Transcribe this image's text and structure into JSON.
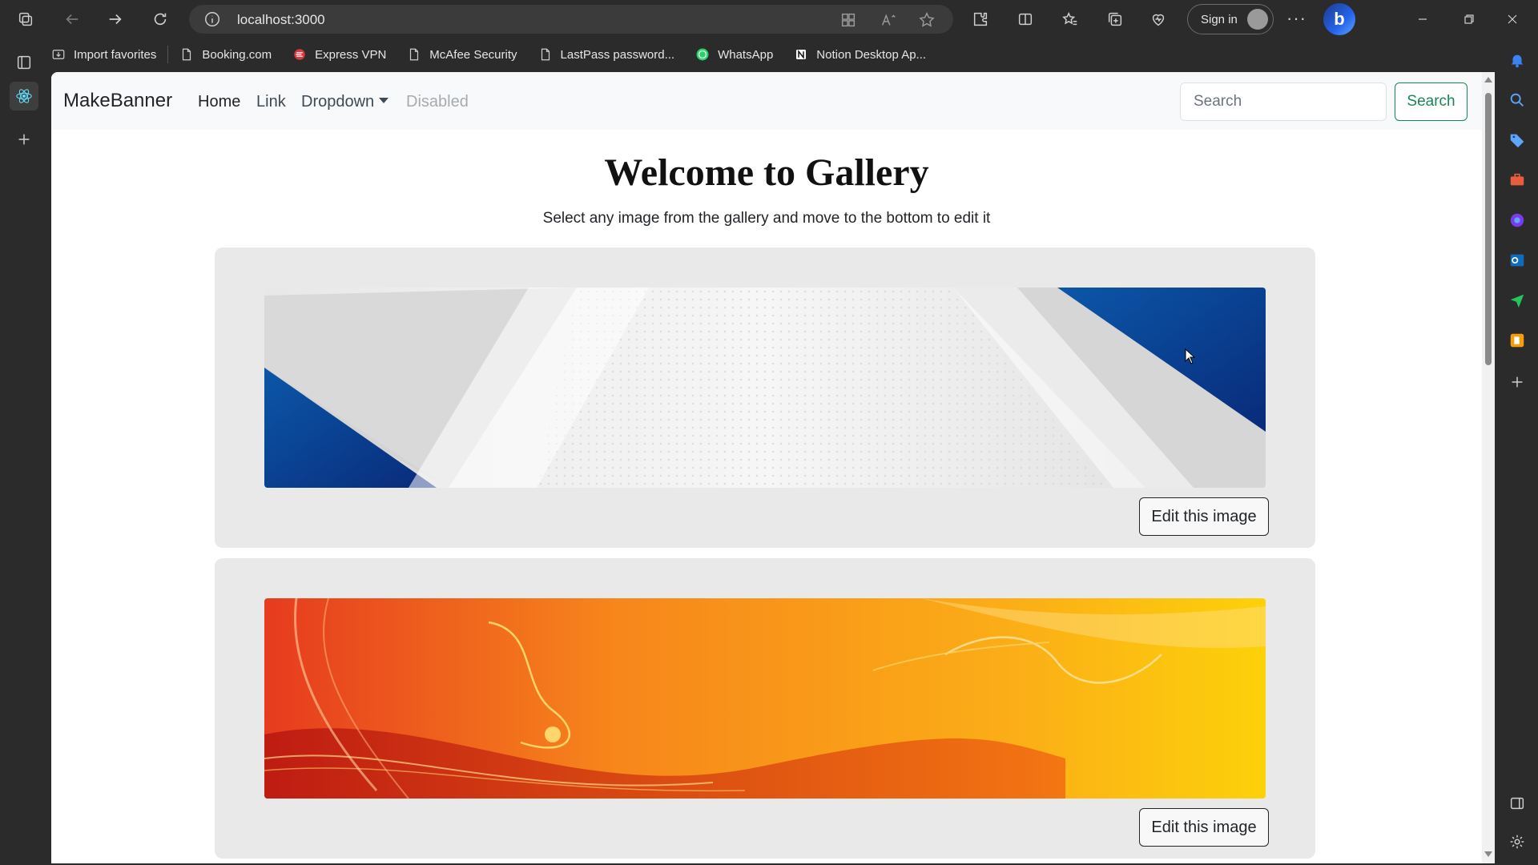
{
  "browser": {
    "url": "localhost:3000",
    "signin_label": "Sign in",
    "more_label": "···",
    "copilot_label": "b"
  },
  "bookmarks": [
    {
      "label": "Import favorites",
      "icon": "import-icon"
    },
    {
      "label": "Booking.com",
      "icon": "page-icon"
    },
    {
      "label": "Express VPN",
      "icon": "expressvpn-icon"
    },
    {
      "label": "McAfee Security",
      "icon": "page-icon"
    },
    {
      "label": "LastPass password...",
      "icon": "page-icon"
    },
    {
      "label": "WhatsApp",
      "icon": "whatsapp-icon"
    },
    {
      "label": "Notion Desktop Ap...",
      "icon": "notion-icon"
    }
  ],
  "navbar": {
    "brand": "MakeBanner",
    "links": [
      "Home",
      "Link",
      "Dropdown",
      "Disabled"
    ],
    "search_placeholder": "Search",
    "search_button": "Search"
  },
  "main": {
    "title": "Welcome to Gallery",
    "subtitle": "Select any image from the gallery and move to the bottom to edit it",
    "cards": [
      {
        "edit_label": "Edit this image",
        "banner": "blue-white-geometric-banner"
      },
      {
        "edit_label": "Edit this image",
        "banner": "orange-floral-banner"
      }
    ]
  },
  "colors": {
    "success": "#198754",
    "navbar_bg": "#f8f9fa",
    "card_bg": "#e9e9e9",
    "chrome_bg": "#2b2b2b"
  }
}
